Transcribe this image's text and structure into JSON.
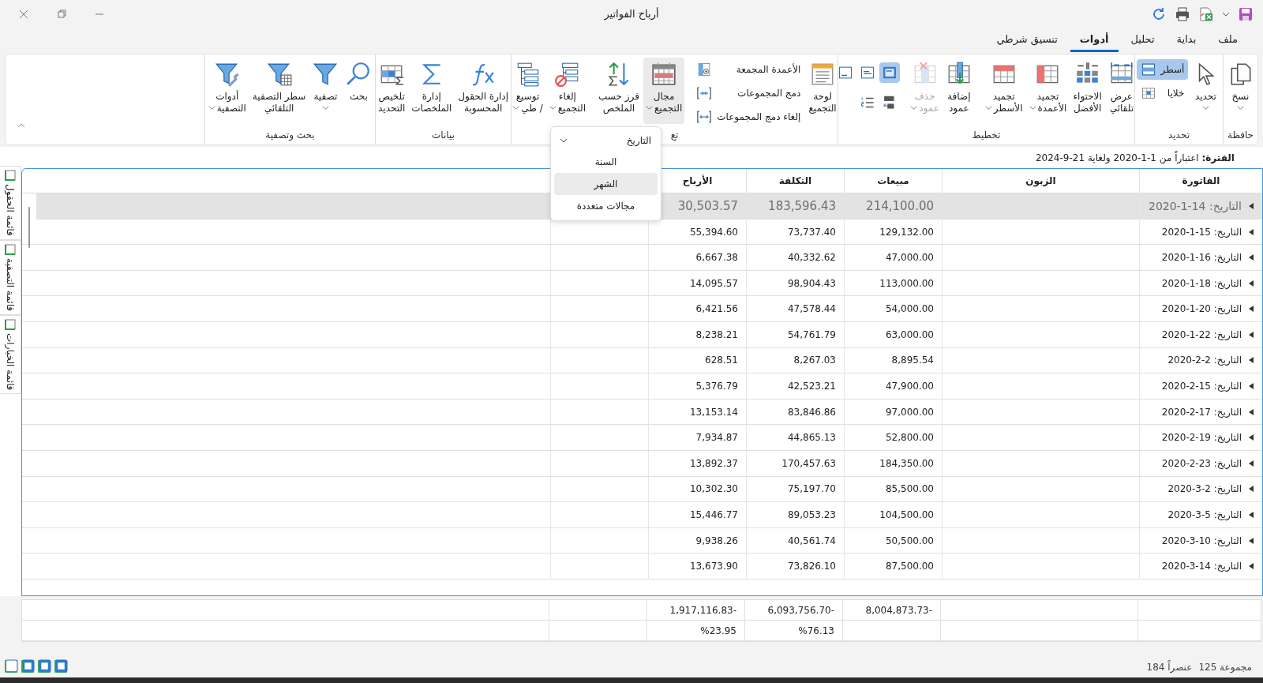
{
  "window": {
    "title": "أرباح الفواتير"
  },
  "ribbon_tabs": [
    {
      "label": "ملف",
      "selected": false
    },
    {
      "label": "بداية",
      "selected": false
    },
    {
      "label": "تحليل",
      "selected": false
    },
    {
      "label": "أدوات",
      "selected": true
    },
    {
      "label": "تنسيق شرطي",
      "selected": false
    }
  ],
  "ribbon_groups": [
    {
      "label": "حافظة",
      "items": [
        {
          "kind": "large",
          "label": "نسخ",
          "dropdown": true,
          "selected": false,
          "disabled": false
        }
      ]
    },
    {
      "label": "تحديد",
      "items": [
        {
          "kind": "large",
          "label": "تحديد",
          "dropdown": true,
          "selected": false,
          "disabled": false
        },
        {
          "kind": "stack",
          "items": [
            {
              "kind": "small",
              "label": "أسطر",
              "selected": true,
              "disabled": false
            },
            {
              "kind": "small",
              "label": "خلايا",
              "selected": false,
              "disabled": false
            }
          ]
        }
      ]
    },
    {
      "label": "تخطيط",
      "items": [
        {
          "kind": "large",
          "label": "عرض\nتلقائي",
          "dropdown": false,
          "selected": false,
          "disabled": false
        },
        {
          "kind": "large",
          "label": "الاحتواء\nالأفضل",
          "dropdown": false,
          "selected": false,
          "disabled": false
        },
        {
          "kind": "large",
          "label": "تجميد\nالأعمدة",
          "dropdown": true,
          "selected": false,
          "disabled": false
        },
        {
          "kind": "large",
          "label": "تجميد\nالأسطر",
          "dropdown": true,
          "selected": false,
          "disabled": false
        },
        {
          "kind": "separator"
        },
        {
          "kind": "large",
          "label": "إضافة\nعمود",
          "dropdown": false,
          "selected": false,
          "disabled": false
        },
        {
          "kind": "large",
          "label": "حذف\nعمود",
          "dropdown": true,
          "selected": false,
          "disabled": true
        },
        {
          "kind": "separator"
        },
        {
          "kind": "iconrows",
          "rows": [
            [
              {
                "selected": true
              },
              {
                "selected": false
              },
              {
                "selected": false
              }
            ],
            [
              {
                "selected": false
              },
              {
                "selected": false
              }
            ]
          ]
        }
      ]
    },
    {
      "label": "تع",
      "items": [
        {
          "kind": "large",
          "label": "لوحة\nالتجميع",
          "dropdown": false,
          "selected": false,
          "disabled": false
        },
        {
          "kind": "stack",
          "items": [
            {
              "kind": "small",
              "label": "الأعمدة المجمعة",
              "selected": false,
              "disabled": false
            },
            {
              "kind": "small",
              "label": "دمج المجموعات",
              "selected": false,
              "disabled": false
            },
            {
              "kind": "small",
              "label": "إلغاء دمج المجموعات",
              "selected": false,
              "disabled": false
            }
          ]
        },
        {
          "kind": "separator"
        },
        {
          "kind": "large",
          "label": "مجال\nالتجميع",
          "dropdown": true,
          "selected": true,
          "disabled": false
        },
        {
          "kind": "large",
          "label": "فرز حسب\nالملخص",
          "dropdown": false,
          "selected": false,
          "disabled": false
        },
        {
          "kind": "separator"
        },
        {
          "kind": "large",
          "label": "إلغاء\nالتجميع",
          "dropdown": true,
          "selected": false,
          "disabled": false
        },
        {
          "kind": "large",
          "label": "توسيع\n/ طي",
          "dropdown": true,
          "selected": false,
          "disabled": false
        }
      ]
    },
    {
      "label": "بيانات",
      "items": [
        {
          "kind": "large",
          "label": "إدارة الحقول\nالمحسوبة",
          "dropdown": false,
          "selected": false,
          "disabled": false
        },
        {
          "kind": "large",
          "label": "إدارة\nالملخصات",
          "dropdown": false,
          "selected": false,
          "disabled": false
        },
        {
          "kind": "large",
          "label": "تلخيص\nالتحديد",
          "dropdown": false,
          "selected": false,
          "disabled": false
        }
      ]
    },
    {
      "label": "بحث وتصفية",
      "items": [
        {
          "kind": "large",
          "label": "بحث",
          "dropdown": false,
          "selected": false,
          "disabled": false
        },
        {
          "kind": "large",
          "label": "تصفية",
          "dropdown": true,
          "selected": false,
          "disabled": false
        },
        {
          "kind": "large",
          "label": "سطر التصفية\nالتلقائي",
          "dropdown": false,
          "selected": false,
          "disabled": false
        },
        {
          "kind": "large",
          "label": "أدوات\nالتصفية",
          "dropdown": true,
          "selected": false,
          "disabled": false
        }
      ]
    }
  ],
  "grouping_menu": {
    "header": "التاريخ",
    "expanded": true,
    "items": [
      {
        "label": "السنة",
        "selected": false
      },
      {
        "label": "الشهر",
        "selected": true
      },
      {
        "label": "مجالات متعددة",
        "selected": false
      }
    ]
  },
  "period": "**الفترة:** اعتباراً من 1-1-2020 ولغاية 21-9-2024",
  "side_tabs": [
    {
      "label": "قائمة الحقول"
    },
    {
      "label": "قائمة التصفية"
    },
    {
      "label": "قائمة الخيارات"
    }
  ],
  "table": {
    "columns": [
      "الفاتورة",
      "الزبون",
      "مبيعات",
      "التكلفة",
      "الأرباح"
    ],
    "rows": [
      {
        "label": "التاريخ: 14-1-2020",
        "sales": "214,100.00",
        "cost": "183,596.43",
        "profit": "30,503.57",
        "selected": true
      },
      {
        "label": "التاريخ: 15-1-2020",
        "sales": "129,132.00",
        "cost": "73,737.40",
        "profit": "55,394.60",
        "selected": false
      },
      {
        "label": "التاريخ: 16-1-2020",
        "sales": "47,000.00",
        "cost": "40,332.62",
        "profit": "6,667.38",
        "selected": false
      },
      {
        "label": "التاريخ: 18-1-2020",
        "sales": "113,000.00",
        "cost": "98,904.43",
        "profit": "14,095.57",
        "selected": false
      },
      {
        "label": "التاريخ: 20-1-2020",
        "sales": "54,000.00",
        "cost": "47,578.44",
        "profit": "6,421.56",
        "selected": false
      },
      {
        "label": "التاريخ: 22-1-2020",
        "sales": "63,000.00",
        "cost": "54,761.79",
        "profit": "8,238.21",
        "selected": false
      },
      {
        "label": "التاريخ: 2-2-2020",
        "sales": "8,895.54",
        "cost": "8,267.03",
        "profit": "628.51",
        "selected": false
      },
      {
        "label": "التاريخ: 15-2-2020",
        "sales": "47,900.00",
        "cost": "42,523.21",
        "profit": "5,376.79",
        "selected": false
      },
      {
        "label": "التاريخ: 17-2-2020",
        "sales": "97,000.00",
        "cost": "83,846.86",
        "profit": "13,153.14",
        "selected": false
      },
      {
        "label": "التاريخ: 19-2-2020",
        "sales": "52,800.00",
        "cost": "44,865.13",
        "profit": "7,934.87",
        "selected": false
      },
      {
        "label": "التاريخ: 23-2-2020",
        "sales": "184,350.00",
        "cost": "170,457.63",
        "profit": "13,892.37",
        "selected": false
      },
      {
        "label": "التاريخ: 2-3-2020",
        "sales": "85,500.00",
        "cost": "75,197.70",
        "profit": "10,302.30",
        "selected": false
      },
      {
        "label": "التاريخ: 5-3-2020",
        "sales": "104,500.00",
        "cost": "89,053.23",
        "profit": "15,446.77",
        "selected": false
      },
      {
        "label": "التاريخ: 10-3-2020",
        "sales": "50,500.00",
        "cost": "40,561.74",
        "profit": "9,938.26",
        "selected": false
      },
      {
        "label": "التاريخ: 14-3-2020",
        "sales": "87,500.00",
        "cost": "73,826.10",
        "profit": "13,673.90",
        "selected": false
      }
    ]
  },
  "summary_rows": [
    {
      "sales": "8,004,873.73-",
      "cost": "6,093,756.70-",
      "profit": "1,917,116.83-"
    },
    {
      "cost": "%76.13",
      "profit": "%23.95"
    }
  ],
  "status_bar": {
    "groups": "125 مجموعة",
    "items": "184 عنصراً"
  }
}
